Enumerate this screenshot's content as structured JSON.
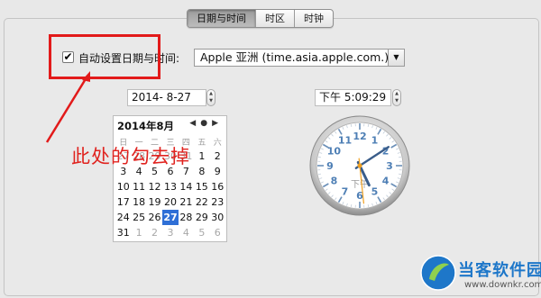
{
  "tabs": [
    {
      "label": "日期与时间",
      "active": true
    },
    {
      "label": "时区",
      "active": false
    },
    {
      "label": "时钟",
      "active": false
    }
  ],
  "auto_set": {
    "checked": true,
    "check_mark": "✔",
    "label": "自动设置日期与时间:",
    "server": "Apple 亚洲 (time.asia.apple.com.)",
    "dropdown_icon": "▼"
  },
  "date_field": {
    "value": "2014- 8-27"
  },
  "time_field": {
    "value": "下午  5:09:29"
  },
  "stepper_icons": {
    "up": "▲",
    "down": "▼"
  },
  "calendar": {
    "title": "2014年8月",
    "nav": "◀●▶",
    "weekdays": [
      "日",
      "一",
      "二",
      "三",
      "四",
      "五",
      "六"
    ],
    "weeks": [
      [
        "27",
        "28",
        "29",
        "30",
        "31",
        "1",
        "2"
      ],
      [
        "3",
        "4",
        "5",
        "6",
        "7",
        "8",
        "9"
      ],
      [
        "10",
        "11",
        "12",
        "13",
        "14",
        "15",
        "16"
      ],
      [
        "17",
        "18",
        "19",
        "20",
        "21",
        "22",
        "23"
      ],
      [
        "24",
        "25",
        "26",
        "27",
        "28",
        "29",
        "30"
      ],
      [
        "31",
        "1",
        "2",
        "3",
        "4",
        "5",
        "6"
      ]
    ],
    "selected": "27"
  },
  "clock": {
    "numbers": [
      "12",
      "1",
      "2",
      "3",
      "4",
      "5",
      "6",
      "7",
      "8",
      "9",
      "10",
      "11"
    ],
    "ampm": "下午",
    "time": "5:09:29"
  },
  "annotation": {
    "text": "此处的勾去掉",
    "color": "#e21a1a"
  },
  "watermark": {
    "name": "当客软件园",
    "url": "www.downkr.com"
  },
  "colors": {
    "selection": "#2f6fd6",
    "annotation_red": "#e21a1a",
    "watermark_blue": "#1e77c9"
  }
}
